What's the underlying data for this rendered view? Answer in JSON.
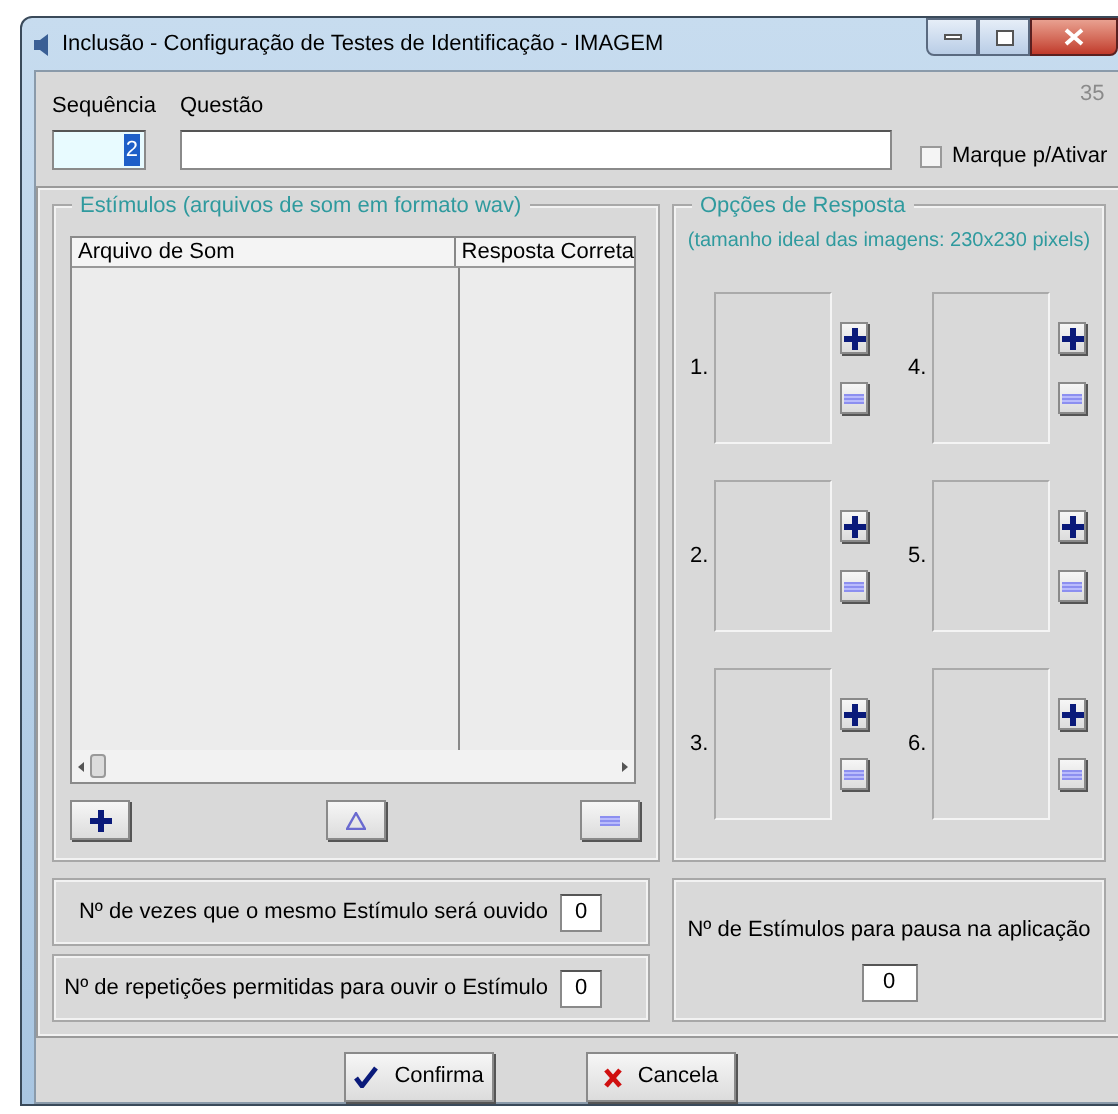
{
  "window": {
    "title": "Inclusão - Configuração de Testes de Identificação - IMAGEM"
  },
  "record_number": "35",
  "sequence": {
    "label": "Sequência",
    "value": "2",
    "selected": true
  },
  "question": {
    "label": "Questão"
  },
  "activate": {
    "label": "Marque p/Ativar",
    "checked": false
  },
  "stimuli": {
    "title": "Estímulos (arquivos de som em formato wav)",
    "columns": [
      "Arquivo de Som",
      "Resposta Correta"
    ]
  },
  "response_options": {
    "title": "Opções de Resposta",
    "hint": "(tamanho ideal das imagens: 230x230 pixels)",
    "slots": [
      {
        "number": "1."
      },
      {
        "number": "2."
      },
      {
        "number": "3."
      },
      {
        "number": "4."
      },
      {
        "number": "5."
      },
      {
        "number": "6."
      }
    ]
  },
  "repeat_fields": [
    {
      "label": "Nº de vezes que o mesmo Estímulo será ouvido",
      "value": "0"
    },
    {
      "label": "Nº de repetições permitidas para ouvir o Estímulo",
      "value": "0"
    }
  ],
  "pause_field": {
    "label": "Nº de Estímulos para pausa na aplicação",
    "value": "0"
  },
  "buttons": [
    {
      "label": "Confirma",
      "kind": "confirm"
    },
    {
      "label": "Cancela",
      "kind": "cancel"
    }
  ]
}
